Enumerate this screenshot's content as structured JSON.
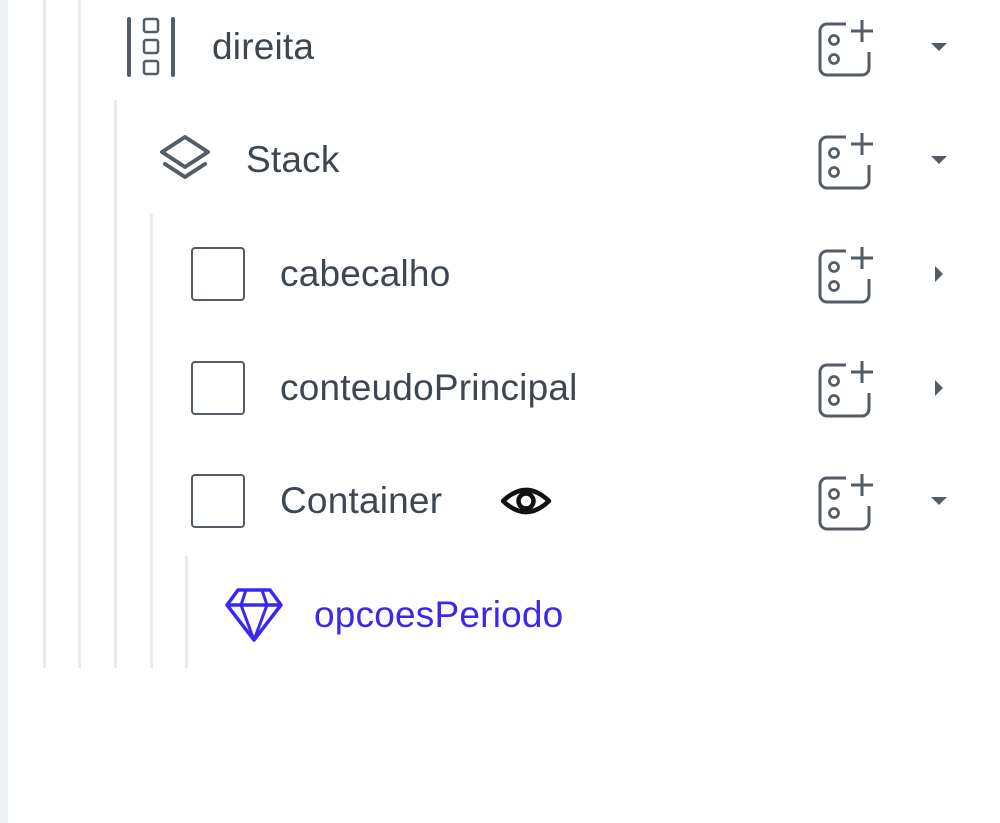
{
  "tree": {
    "items": [
      {
        "label": "direita",
        "icon": "column-layout-icon",
        "caret": "expanded",
        "selected": false
      },
      {
        "label": "Stack",
        "icon": "layers-icon",
        "caret": "expanded",
        "selected": false
      },
      {
        "label": "cabecalho",
        "icon": "container-box-icon",
        "caret": "collapsed",
        "selected": false
      },
      {
        "label": "conteudoPrincipal",
        "icon": "container-box-icon",
        "caret": "collapsed",
        "selected": false
      },
      {
        "label": "Container",
        "icon": "container-box-icon",
        "caret": "expanded",
        "selected": false,
        "visibility_icon": "eye-icon"
      },
      {
        "label": "opcoesPeriodo",
        "icon": "diamond-component-icon",
        "selected": true
      }
    ],
    "action_icon": "add-widget-icon"
  },
  "colors": {
    "text": "#3e4751",
    "icon": "#545d66",
    "selected": "#3a28f0",
    "guides": "#e7eaee",
    "left_strip": "#eef1f4"
  }
}
